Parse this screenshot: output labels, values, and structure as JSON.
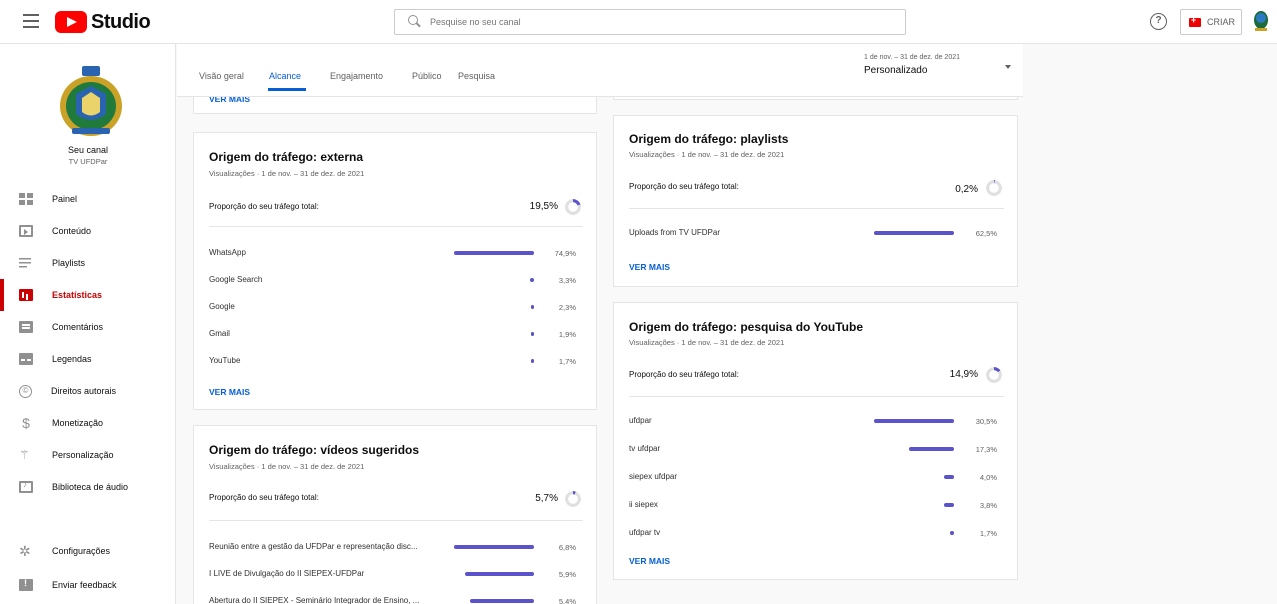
{
  "header": {
    "app_name": "Studio",
    "search_placeholder": "Pesquise no seu canal",
    "help_glyph": "?",
    "create_label": "CRIAR"
  },
  "channel": {
    "name": "Seu canal",
    "handle": "TV UFDPar"
  },
  "sidebar": {
    "items": [
      {
        "label": "Painel",
        "icon": "dashboard-icon"
      },
      {
        "label": "Conteúdo",
        "icon": "content-icon"
      },
      {
        "label": "Playlists",
        "icon": "playlists-icon"
      },
      {
        "label": "Estatísticas",
        "icon": "analytics-icon",
        "active": true
      },
      {
        "label": "Comentários",
        "icon": "comments-icon"
      },
      {
        "label": "Legendas",
        "icon": "subtitles-icon"
      },
      {
        "label": "Direitos autorais",
        "icon": "copyright-icon"
      },
      {
        "label": "Monetização",
        "icon": "monetization-icon"
      },
      {
        "label": "Personalização",
        "icon": "customization-icon"
      },
      {
        "label": "Biblioteca de áudio",
        "icon": "audio-library-icon"
      }
    ],
    "footer": [
      {
        "label": "Configurações",
        "icon": "settings-icon"
      },
      {
        "label": "Enviar feedback",
        "icon": "feedback-icon"
      }
    ],
    "copyright_glyph": "©",
    "money_glyph": "$",
    "wand_glyph": "⚚",
    "gear_glyph": "✲"
  },
  "tabs": {
    "items": [
      "Visão geral",
      "Alcance",
      "Engajamento",
      "Público",
      "Pesquisa"
    ],
    "active": "Alcance"
  },
  "date_range": {
    "range": "1 de nov. – 31 de dez. de 2021",
    "label": "Personalizado"
  },
  "common": {
    "ver_mais": "VER MAIS",
    "subtitle": "Visualizações · 1 de nov. – 31 de dez. de 2021",
    "share_label": "Proporção do seu tráfego total:"
  },
  "cards": {
    "externa": {
      "title": "Origem do tráfego: externa",
      "share": "19,5%",
      "share_fraction": 0.195,
      "rows": [
        {
          "label": "WhatsApp",
          "pct": "74,9%",
          "value": 74.9
        },
        {
          "label": "Google Search",
          "pct": "3,3%",
          "value": 3.3
        },
        {
          "label": "Google",
          "pct": "2,3%",
          "value": 2.3
        },
        {
          "label": "Gmail",
          "pct": "1,9%",
          "value": 1.9
        },
        {
          "label": "YouTube",
          "pct": "1,7%",
          "value": 1.7
        }
      ]
    },
    "sugeridos": {
      "title": "Origem do tráfego: vídeos sugeridos",
      "share": "5,7%",
      "share_fraction": 0.057,
      "rows": [
        {
          "label": "Reunião entre a gestão da UFDPar e representação disc...",
          "pct": "6,8%",
          "value": 6.8
        },
        {
          "label": "I LIVE de Divulgação do II SIEPEX-UFDPar",
          "pct": "5,9%",
          "value": 5.9
        },
        {
          "label": "Abertura do II SIEPEX - Seminário Integrador de Ensino, ...",
          "pct": "5,4%",
          "value": 5.4
        }
      ]
    },
    "playlists": {
      "title": "Origem do tráfego: playlists",
      "share": "0,2%",
      "share_fraction": 0.002,
      "rows": [
        {
          "label": "Uploads from TV UFDPar",
          "pct": "62,5%",
          "value": 62.5
        }
      ]
    },
    "pesquisa": {
      "title": "Origem do tráfego: pesquisa do YouTube",
      "share": "14,9%",
      "share_fraction": 0.149,
      "rows": [
        {
          "label": "ufdpar",
          "pct": "30,5%",
          "value": 30.5
        },
        {
          "label": "tv ufdpar",
          "pct": "17,3%",
          "value": 17.3
        },
        {
          "label": "siepex ufdpar",
          "pct": "4,0%",
          "value": 4.0
        },
        {
          "label": "ii siepex",
          "pct": "3,8%",
          "value": 3.8
        },
        {
          "label": "ufdpar tv",
          "pct": "1,7%",
          "value": 1.7
        }
      ]
    }
  },
  "colors": {
    "accent": "#065fd4",
    "brand": "#ff0000",
    "active_nav": "#cc0000",
    "bar": "#5a53c9"
  }
}
